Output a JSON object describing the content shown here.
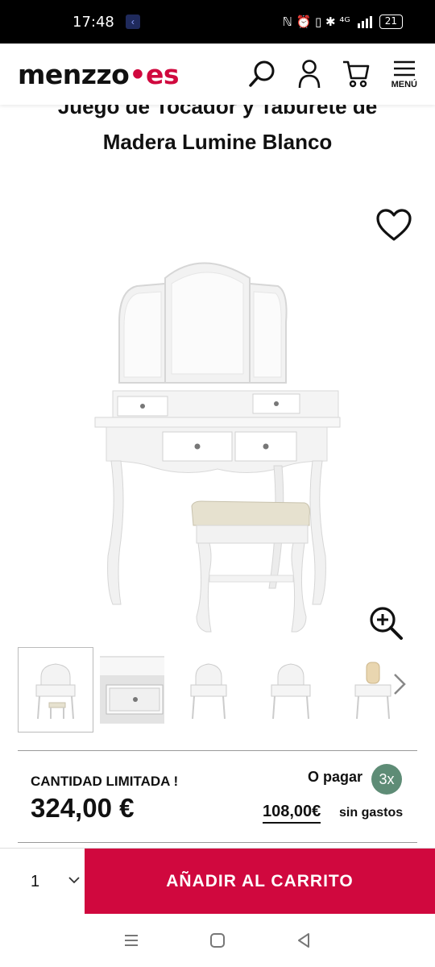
{
  "status_bar": {
    "time": "17:48",
    "notification_icon": "back-arrow-icon",
    "right_text": "ℕ ⏰ ▯ ✱ ⁴ᴳ",
    "battery": "21"
  },
  "header": {
    "logo": {
      "part1": "menzzo",
      "dot": "•",
      "part2": "es"
    },
    "icons": [
      "search-icon",
      "user-icon",
      "cart-icon",
      "menu-icon"
    ],
    "menu_label": "MENÚ"
  },
  "product": {
    "title_line1": "Juego de Tocador y Taburete de",
    "title_line2": "Madera Lumine Blanco",
    "thumbnails_count": 5
  },
  "pricing": {
    "limited_label": "CANTIDAD LIMITADA !",
    "price": "324,00 €",
    "o_pagar": "O pagar",
    "installments_badge": "3x",
    "installment_amount": "108,00€",
    "sin_gastos": "sin gastos"
  },
  "bottom_bar": {
    "quantity": "1",
    "add_to_cart": "AÑADIR AL CARRITO"
  },
  "colors": {
    "brand": "#d0083e",
    "badge": "#5e8c76"
  }
}
